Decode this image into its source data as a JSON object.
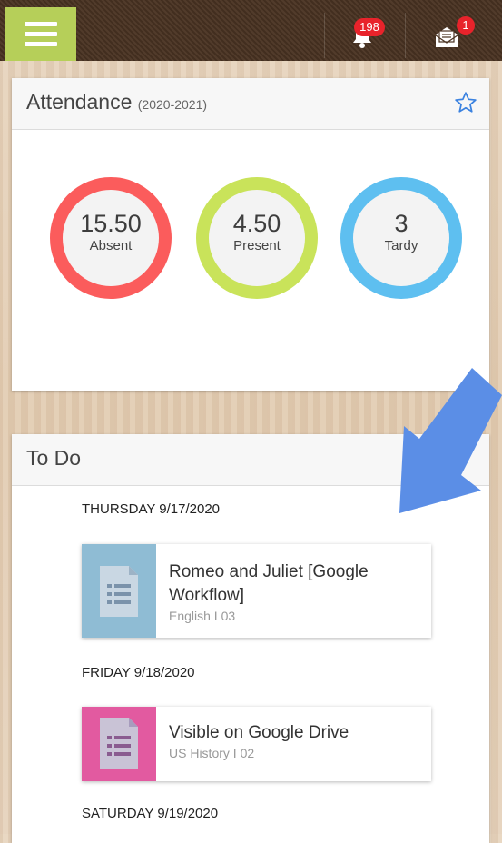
{
  "header": {
    "menu_label": "menu",
    "notification_count": "198",
    "message_count": "1"
  },
  "attendance": {
    "title": "Attendance",
    "year": "(2020-2021)",
    "stats": [
      {
        "value": "15.50",
        "label": "Absent",
        "color": "#fb5c5c"
      },
      {
        "value": "4.50",
        "label": "Present",
        "color": "#c9e35a"
      },
      {
        "value": "3",
        "label": "Tardy",
        "color": "#5ebff0"
      }
    ]
  },
  "todo": {
    "title": "To Do",
    "groups": [
      {
        "date": "THURSDAY 9/17/2020",
        "item": {
          "title": "Romeo and Juliet [Google Workflow]",
          "course": "English I 03",
          "icon_color": "#8fbcd4"
        }
      },
      {
        "date": "FRIDAY 9/18/2020",
        "item": {
          "title": "Visible on Google Drive",
          "course": "US History I 02",
          "icon_color": "#e25aa0"
        }
      },
      {
        "date": "SATURDAY 9/19/2020"
      }
    ]
  },
  "colors": {
    "accent": "#b6cf59",
    "arrow": "#5b8ee6",
    "star": "#3b82e0"
  }
}
